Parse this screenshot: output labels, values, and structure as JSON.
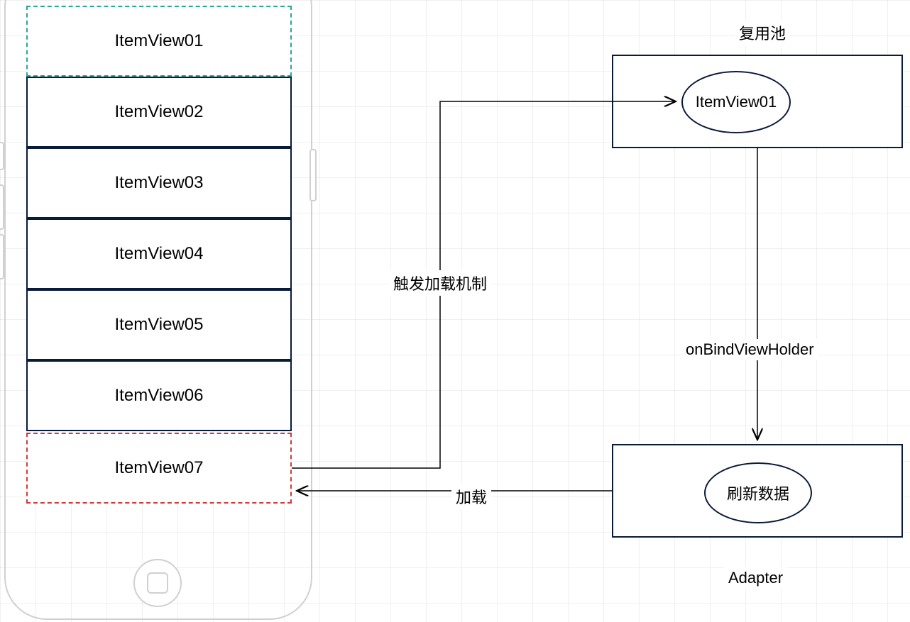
{
  "phone": {
    "items": [
      {
        "label": "ItemView01",
        "style": "dash-teal"
      },
      {
        "label": "ItemView02",
        "style": "solid"
      },
      {
        "label": "ItemView03",
        "style": "solid"
      },
      {
        "label": "ItemView04",
        "style": "solid"
      },
      {
        "label": "ItemView05",
        "style": "solid"
      },
      {
        "label": "ItemView06",
        "style": "solid"
      },
      {
        "label": "ItemView07",
        "style": "dash-red"
      }
    ]
  },
  "pool": {
    "title": "复用池",
    "item": "ItemView01"
  },
  "adapter": {
    "title": "Adapter",
    "action": "刷新数据"
  },
  "arrows": {
    "trigger_label": "触发加载机制",
    "bind_label": "onBindViewHolder",
    "load_label": "加载"
  }
}
